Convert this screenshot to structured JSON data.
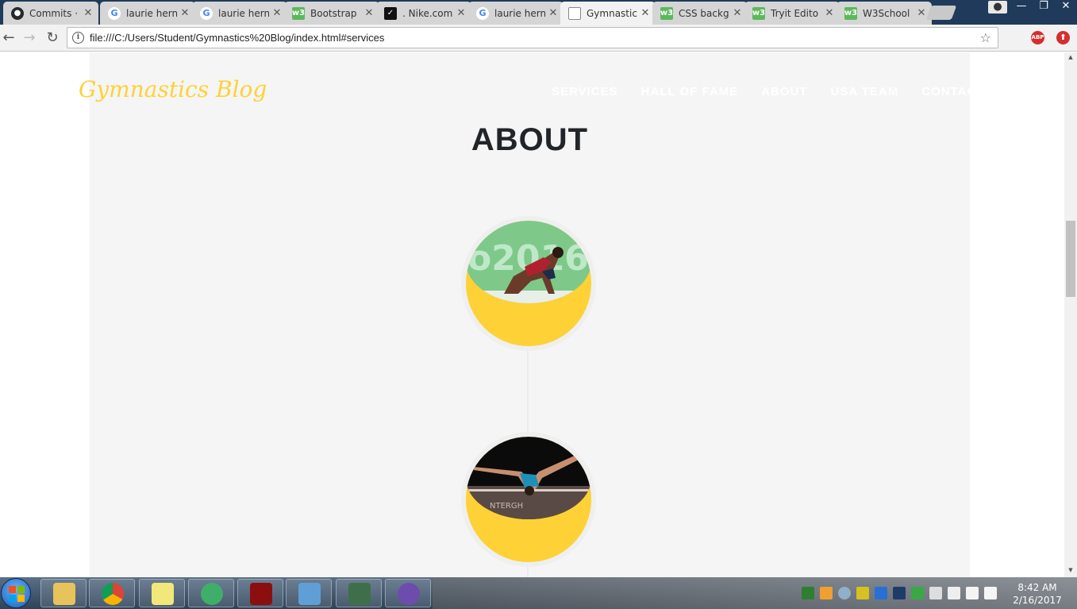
{
  "browser": {
    "tabs": [
      {
        "title": "Commits ·",
        "favicon": "github-icon",
        "active": false
      },
      {
        "title": "laurie hern",
        "favicon": "google-icon",
        "active": false
      },
      {
        "title": "laurie hern",
        "favicon": "google-icon",
        "active": false
      },
      {
        "title": "Bootstrap",
        "favicon": "w3schools-icon",
        "active": false
      },
      {
        "title": ". Nike.com",
        "favicon": "nike-icon",
        "active": false
      },
      {
        "title": "laurie hern",
        "favicon": "google-icon",
        "active": false
      },
      {
        "title": "Gymnastic",
        "favicon": "document-icon",
        "active": true
      },
      {
        "title": "CSS backg",
        "favicon": "w3schools-icon",
        "active": false
      },
      {
        "title": "Tryit Edito",
        "favicon": "w3schools-icon",
        "active": false
      },
      {
        "title": "W3School",
        "favicon": "w3schools-icon",
        "active": false
      }
    ],
    "url": "file:///C:/Users/Student/Gymnastics%20Blog/index.html#services",
    "extensions": [
      "ABP",
      ""
    ]
  },
  "page": {
    "brand": "Gymnastics Blog",
    "nav": [
      "SERVICES",
      "HALL OF FAME",
      "ABOUT",
      "USA TEAM",
      "CONTACT"
    ],
    "section_heading": "ABOUT",
    "timeline": [
      {
        "image": "gymnast-floor-rio-2016"
      },
      {
        "image": "gymnast-balance-beam"
      }
    ],
    "colors": {
      "accent": "#fed136",
      "section_bg": "#f5f5f5",
      "heading": "#212529"
    }
  },
  "taskbar": {
    "time": "8:42 AM",
    "date": "2/16/2017"
  }
}
